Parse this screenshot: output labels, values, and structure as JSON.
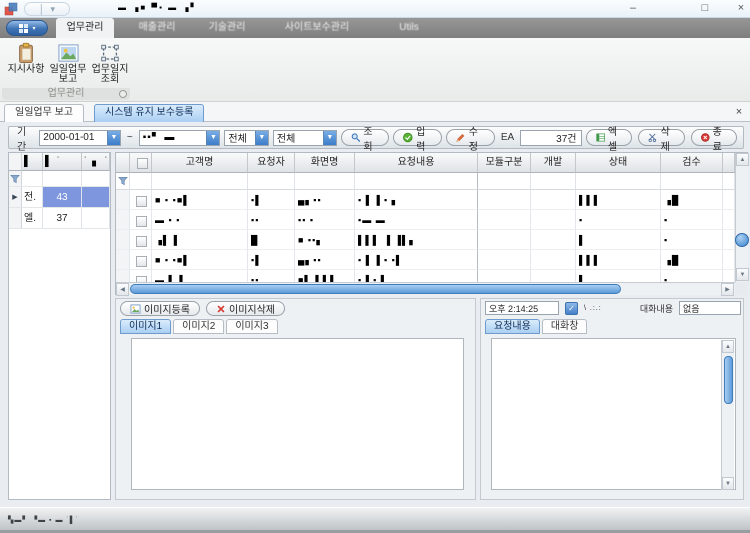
{
  "colors": {
    "selection": "#7e96de",
    "accent_blue": "#3b82cc",
    "active_tab": "#aacef2"
  },
  "window": {
    "title_marks": "▬ ▗■ ▀▪  ▬ ▗▘",
    "minimize": "–",
    "maximize": "□",
    "close": "×"
  },
  "ribbon": {
    "tabs": [
      {
        "label": "업무관리",
        "active": true
      },
      {
        "label": "매출관리"
      },
      {
        "label": "기술관리"
      },
      {
        "label": "사이트보수관리"
      },
      {
        "label": "Utils"
      }
    ],
    "group": {
      "label": "업무관리",
      "buttons": [
        {
          "label": "지시사항"
        },
        {
          "label": "일일업무\n보고"
        },
        {
          "label": "업무일지\n조회"
        }
      ]
    }
  },
  "doc_tabs": [
    {
      "label": "일일업무 보고"
    },
    {
      "label": "시스템 유지 보수등록",
      "active": true
    }
  ],
  "toolbar": {
    "period_label": "기간",
    "date_from": "2000-01-01",
    "date_to_marks": "▪▪▘ ▬",
    "tilde": "~",
    "filter1": "전체",
    "filter2": "전체",
    "search": "조회",
    "input": "입력",
    "edit": "수정",
    "ea_label": "EA",
    "count": "37건",
    "excel": "엑셀",
    "delete": "삭제",
    "exit": "종료",
    "dropdown_glyph": "▼"
  },
  "left_grid": {
    "headers": [
      "▌",
      "▌ ˙",
      "˙ ▖ ˙"
    ],
    "rows": [
      {
        "label": "전.",
        "value": "43",
        "selected": true
      },
      {
        "label": "엘.",
        "value": "37",
        "selected": false
      }
    ],
    "pointer": "▶"
  },
  "main_grid": {
    "headers": [
      "고객명",
      "요청자",
      "화면명",
      "요청내용",
      "모듈구분",
      "개발",
      "상태",
      "검수"
    ],
    "rows": [
      {
        "cells": [
          "■ ▪ ▪■▌",
          "▪▌",
          "▄▖▪▪",
          "▪ ▌ ▌▪ ▖",
          "",
          "",
          "▌▌▌",
          "▗█"
        ]
      },
      {
        "cells": [
          "▬ ▪ ▪",
          "▪▪",
          "▪▪ ▪",
          "▪▬ ▬",
          "",
          "",
          "▪",
          "▪"
        ]
      },
      {
        "cells": [
          "▗▌ ▌",
          "█",
          "■ ▪▪▖",
          "▌▌▌ ▐ ▐▌▖",
          "",
          "",
          "▌",
          "▪"
        ]
      },
      {
        "cells": [
          "■ ▪ ▪■▌",
          "▪▌",
          "▄▖▪▪",
          "▪ ▌ ▌▪ ▪▌",
          "",
          "",
          "▌▌▌",
          "▗█"
        ]
      },
      {
        "cells": [
          "▬ ▌ ▌",
          "▪▪",
          "■▌ ▌▌▌",
          "▪ ▌▪ ▌",
          "",
          "",
          "▌",
          "▪"
        ]
      }
    ],
    "scroll": {
      "up": "▲",
      "down": "▼",
      "left": "◀",
      "right": "▶"
    }
  },
  "image_panel": {
    "register": "이미지등록",
    "remove": "이미지삭제",
    "tabs": [
      {
        "label": "이미지1",
        "active": true
      },
      {
        "label": "이미지2",
        "active": false
      },
      {
        "label": "이미지3",
        "active": false
      }
    ]
  },
  "chat_panel": {
    "time": "오후 2:14:25",
    "calendar_glyph": "✓",
    "marks": "\\ .:.:",
    "label": "대화내용",
    "value": "없음",
    "tabs": [
      {
        "label": "요청내용",
        "active": true
      },
      {
        "label": "대화창",
        "active": false
      }
    ],
    "scroll": {
      "up": "▲",
      "down": "▼"
    }
  },
  "status": {
    "marks": "▚▬▘ ▝▬ ▪ ▬ ˙▌˙"
  }
}
